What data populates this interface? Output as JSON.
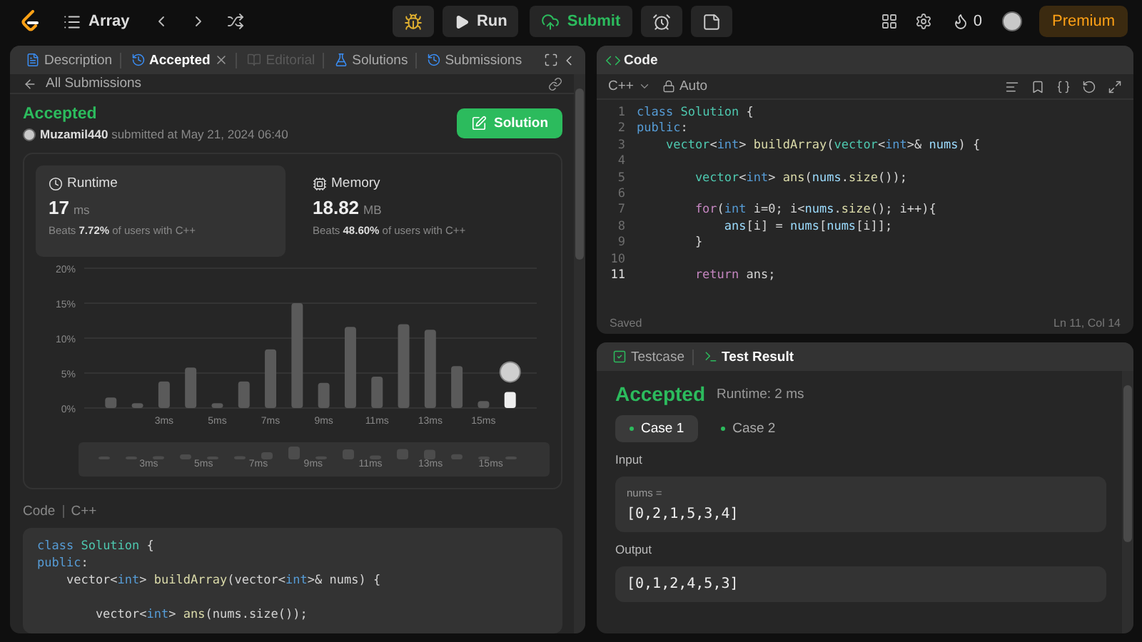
{
  "topbar": {
    "problem_list": "Array",
    "run": "Run",
    "submit": "Submit",
    "streak": "0",
    "premium": "Premium"
  },
  "left_tabs": [
    {
      "label": "Description",
      "selected": false,
      "disabled": false,
      "closable": false
    },
    {
      "label": "Accepted",
      "selected": true,
      "disabled": false,
      "closable": true
    },
    {
      "label": "Editorial",
      "selected": false,
      "disabled": true,
      "closable": false
    },
    {
      "label": "Solutions",
      "selected": false,
      "disabled": false,
      "closable": false
    },
    {
      "label": "Submissions",
      "selected": false,
      "disabled": false,
      "closable": false
    }
  ],
  "back_link": "All Submissions",
  "submission": {
    "status": "Accepted",
    "byline": "**Muzamil440** submitted at May 21, 2024 06:40",
    "solution_button": "Solution"
  },
  "stats": [
    {
      "kind": "runtime",
      "title": "Runtime",
      "value": "17",
      "unit": "ms",
      "beats": "Beats **7.72%** of users with C++",
      "selected": true
    },
    {
      "kind": "memory",
      "title": "Memory",
      "value": "18.82",
      "unit": "MB",
      "beats": "Beats **48.60%** of users with C++",
      "selected": false
    }
  ],
  "chart_data": {
    "type": "bar",
    "x": [
      1,
      2,
      3,
      4,
      5,
      6,
      7,
      8,
      9,
      10,
      11,
      12,
      13,
      14,
      15,
      16
    ],
    "series": [
      {
        "color": "#5a5a5a",
        "values": [
          1.5,
          0.7,
          3.8,
          5.8,
          0.7,
          3.8,
          8.4,
          15,
          3.6,
          11.6,
          4.5,
          12,
          11.2,
          6,
          1,
          null
        ]
      },
      {
        "color": "#eeeeee",
        "values": [
          null,
          null,
          null,
          null,
          null,
          null,
          null,
          null,
          null,
          null,
          null,
          null,
          null,
          null,
          null,
          2.3
        ]
      }
    ],
    "grid": true,
    "xlim": [
      0,
      17
    ],
    "ylim": [
      0,
      20
    ],
    "yticks": [
      {
        "value": 0,
        "label": "0%"
      },
      {
        "value": 5,
        "label": "5%"
      },
      {
        "value": 10,
        "label": "10%"
      },
      {
        "value": 15,
        "label": "15%"
      },
      {
        "value": 20,
        "label": "20%"
      }
    ],
    "xticks": [
      {
        "value": 3,
        "label": "3ms"
      },
      {
        "value": 5,
        "label": "5ms"
      },
      {
        "value": 7,
        "label": "7ms"
      },
      {
        "value": 9,
        "label": "9ms"
      },
      {
        "value": 11,
        "label": "11ms"
      },
      {
        "value": 13,
        "label": "13ms"
      },
      {
        "value": 15,
        "label": "15ms"
      }
    ]
  },
  "navigator": {
    "labels": [
      "3ms",
      "5ms",
      "7ms",
      "9ms",
      "11ms",
      "13ms",
      "15ms"
    ]
  },
  "code_section": {
    "label": "Code",
    "language": "C++",
    "lines": [
      {
        "tokens": [
          {
            "text": "class",
            "kind": "keyword"
          },
          {
            "text": " Solution",
            "kind": "type"
          },
          {
            "text": " {",
            "kind": "plain"
          }
        ]
      },
      {
        "tokens": [
          {
            "text": "public",
            "kind": "keyword"
          },
          {
            "text": ":",
            "kind": "plain"
          }
        ]
      },
      {
        "tokens": [
          {
            "text": "    vector<",
            "kind": "plain"
          },
          {
            "text": "int",
            "kind": "keyword"
          },
          {
            "text": ">",
            "kind": "plain"
          },
          {
            "text": " buildArray",
            "kind": "function"
          },
          {
            "text": "(vector<",
            "kind": "plain"
          },
          {
            "text": "int",
            "kind": "keyword"
          },
          {
            "text": ">& nums) {",
            "kind": "plain"
          }
        ]
      },
      {
        "kind": "blank"
      },
      {
        "tokens": [
          {
            "text": "        vector<",
            "kind": "plain"
          },
          {
            "text": "int",
            "kind": "keyword"
          },
          {
            "text": ">",
            "kind": "plain"
          },
          {
            "text": " ans",
            "kind": "function"
          },
          {
            "text": "(nums.size());",
            "kind": "plain"
          }
        ]
      }
    ]
  },
  "editor": {
    "title": "Code",
    "language": "C++",
    "mode": "Auto",
    "status": "Saved",
    "position": "Ln 11, Col 14",
    "lines": [
      {
        "n": "1",
        "active": false,
        "tokens": [
          {
            "text": "class",
            "kind": "keyword"
          },
          {
            "text": " Solution",
            "kind": "type"
          },
          {
            "text": " {",
            "kind": "plain"
          }
        ]
      },
      {
        "n": "2",
        "active": false,
        "tokens": [
          {
            "text": "public",
            "kind": "keyword"
          },
          {
            "text": ":",
            "kind": "plain"
          }
        ]
      },
      {
        "n": "3",
        "active": false,
        "tokens": [
          {
            "text": "    vector",
            "kind": "type"
          },
          {
            "text": "<",
            "kind": "plain"
          },
          {
            "text": "int",
            "kind": "keyword"
          },
          {
            "text": ">",
            "kind": "plain"
          },
          {
            "text": " buildArray",
            "kind": "function"
          },
          {
            "text": "(",
            "kind": "plain"
          },
          {
            "text": "vector",
            "kind": "type"
          },
          {
            "text": "<",
            "kind": "plain"
          },
          {
            "text": "int",
            "kind": "keyword"
          },
          {
            "text": ">&",
            "kind": "plain"
          },
          {
            "text": " nums",
            "kind": "variable"
          },
          {
            "text": ") {",
            "kind": "plain"
          }
        ]
      },
      {
        "n": "4",
        "active": false
      },
      {
        "n": "5",
        "active": false,
        "tokens": [
          {
            "text": "        vector",
            "kind": "type"
          },
          {
            "text": "<",
            "kind": "plain"
          },
          {
            "text": "int",
            "kind": "keyword"
          },
          {
            "text": ">",
            "kind": "plain"
          },
          {
            "text": " ans",
            "kind": "function"
          },
          {
            "text": "(",
            "kind": "plain"
          },
          {
            "text": "nums",
            "kind": "variable"
          },
          {
            "text": ".",
            "kind": "plain"
          },
          {
            "text": "size",
            "kind": "function"
          },
          {
            "text": "());",
            "kind": "plain"
          }
        ]
      },
      {
        "n": "6",
        "active": false
      },
      {
        "n": "7",
        "active": false,
        "tokens": [
          {
            "text": "        for",
            "kind": "control"
          },
          {
            "text": "(",
            "kind": "plain"
          },
          {
            "text": "int",
            "kind": "keyword"
          },
          {
            "text": " i=0; i<",
            "kind": "plain"
          },
          {
            "text": "nums",
            "kind": "variable"
          },
          {
            "text": ".",
            "kind": "plain"
          },
          {
            "text": "size",
            "kind": "function"
          },
          {
            "text": "(); i++){",
            "kind": "plain"
          }
        ]
      },
      {
        "n": "8",
        "active": false,
        "tokens": [
          {
            "text": "            ans",
            "kind": "variable"
          },
          {
            "text": "[i] =",
            "kind": "plain"
          },
          {
            "text": " nums",
            "kind": "variable"
          },
          {
            "text": "[",
            "kind": "plain"
          },
          {
            "text": "nums",
            "kind": "variable"
          },
          {
            "text": "[i]];",
            "kind": "plain"
          }
        ]
      },
      {
        "n": "9",
        "active": false,
        "tokens": [
          {
            "text": "        }",
            "kind": "plain"
          }
        ]
      },
      {
        "n": "10",
        "active": false
      },
      {
        "n": "11",
        "active": true,
        "tokens": [
          {
            "text": "        return",
            "kind": "control"
          },
          {
            "text": " ans;",
            "kind": "plain"
          }
        ]
      }
    ]
  },
  "results": {
    "tabs": [
      {
        "label": "Testcase",
        "selected": false
      },
      {
        "label": "Test Result",
        "selected": true
      }
    ],
    "status": "Accepted",
    "runtime": "Runtime: 2 ms",
    "cases": [
      {
        "label": "Case 1",
        "selected": true,
        "passed": true
      },
      {
        "label": "Case 2",
        "selected": false,
        "passed": true
      }
    ],
    "input_label": "Input",
    "inputs": [
      {
        "name": "nums =",
        "value": "[0,2,1,5,3,4]"
      }
    ],
    "output_label": "Output",
    "output": "[0,1,2,4,5,3]"
  }
}
